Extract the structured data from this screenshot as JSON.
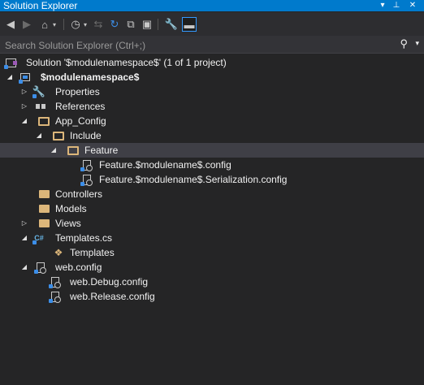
{
  "window": {
    "title": "Solution Explorer"
  },
  "title_buttons": [
    "dropdown-icon",
    "pin-icon",
    "close-icon"
  ],
  "toolbar": {
    "items": [
      "back-icon",
      "forward-icon",
      "home-icon",
      "switch-views-icon",
      "pending-changes-icon",
      "sync-icon",
      "refresh-icon",
      "collapse-all-icon",
      "show-all-files-icon",
      "properties-icon",
      "preview-icon"
    ]
  },
  "search": {
    "placeholder": "Search Solution Explorer (Ctrl+;)"
  },
  "tree": {
    "solution": "Solution '$modulenamespace$' (1 of 1 project)",
    "project": "$modulenamespace$",
    "properties": "Properties",
    "references": "References",
    "app_config": "App_Config",
    "include": "Include",
    "feature": "Feature",
    "feature_config": "Feature.$modulename$.config",
    "serialization_config": "Feature.$modulename$.Serialization.config",
    "controllers": "Controllers",
    "models": "Models",
    "views": "Views",
    "templates_cs": "Templates.cs",
    "templates": "Templates",
    "web_config": "web.config",
    "web_debug": "web.Debug.config",
    "web_release": "web.Release.config"
  },
  "colors": {
    "accent": "#007acc",
    "background": "#252526",
    "selection": "#3f3f46",
    "folder": "#dcb67a"
  }
}
